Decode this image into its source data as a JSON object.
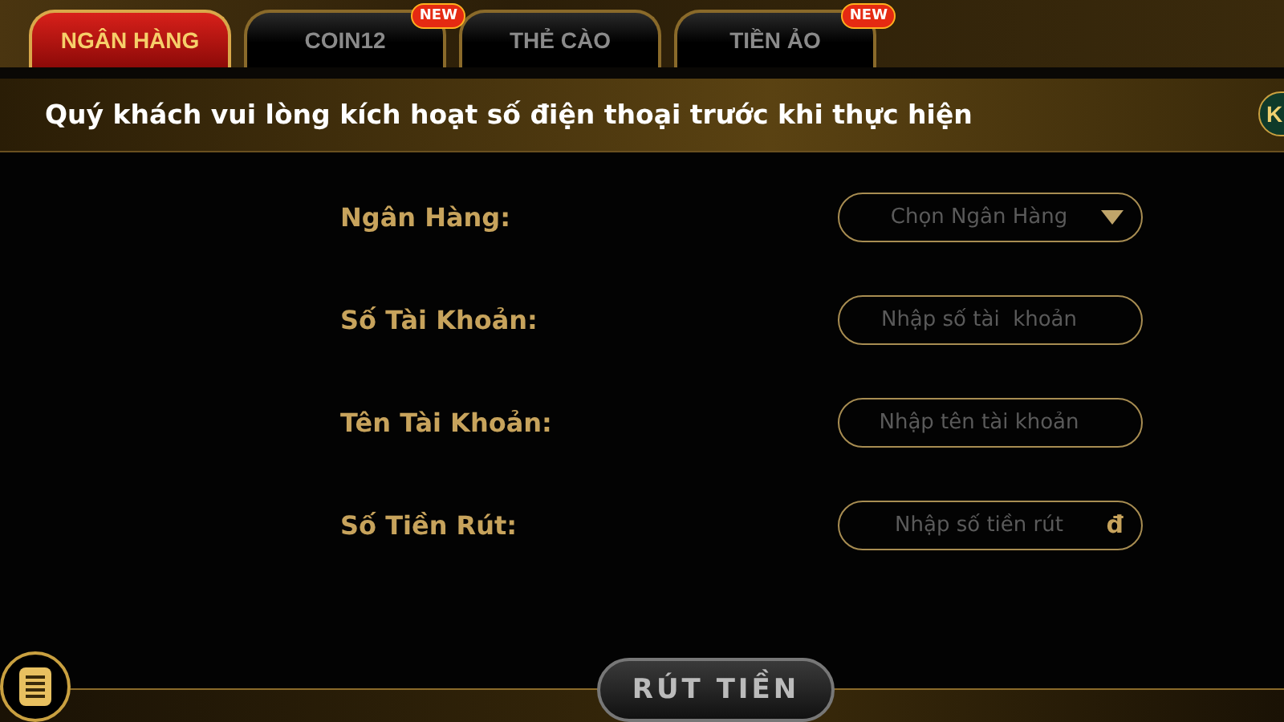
{
  "tabs": [
    {
      "label": "NGÂN HÀNG",
      "selected": true
    },
    {
      "label": "COIN12",
      "selected": false,
      "badge": "NEW"
    },
    {
      "label": "THẺ CÀO",
      "selected": false
    },
    {
      "label": "TIỀN ẢO",
      "selected": false,
      "badge": "NEW"
    }
  ],
  "notice": "Quý khách vui lòng kích hoạt số điện thoại trước khi thực hiện",
  "side_button": "K",
  "form": [
    {
      "kind": "select",
      "label": "Ngân Hàng:",
      "placeholder": "Chọn Ngân Hàng"
    },
    {
      "kind": "text",
      "label": "Số Tài Khoản:",
      "placeholder": "Nhập số tài  khoản"
    },
    {
      "kind": "text",
      "label": "Tên Tài Khoản:",
      "placeholder": "Nhập tên tài khoản"
    },
    {
      "kind": "money",
      "label": "Số Tiền Rút:",
      "placeholder": "Nhập số tiền rút",
      "suffix": "đ"
    }
  ],
  "submit": "RÚT TIỀN"
}
